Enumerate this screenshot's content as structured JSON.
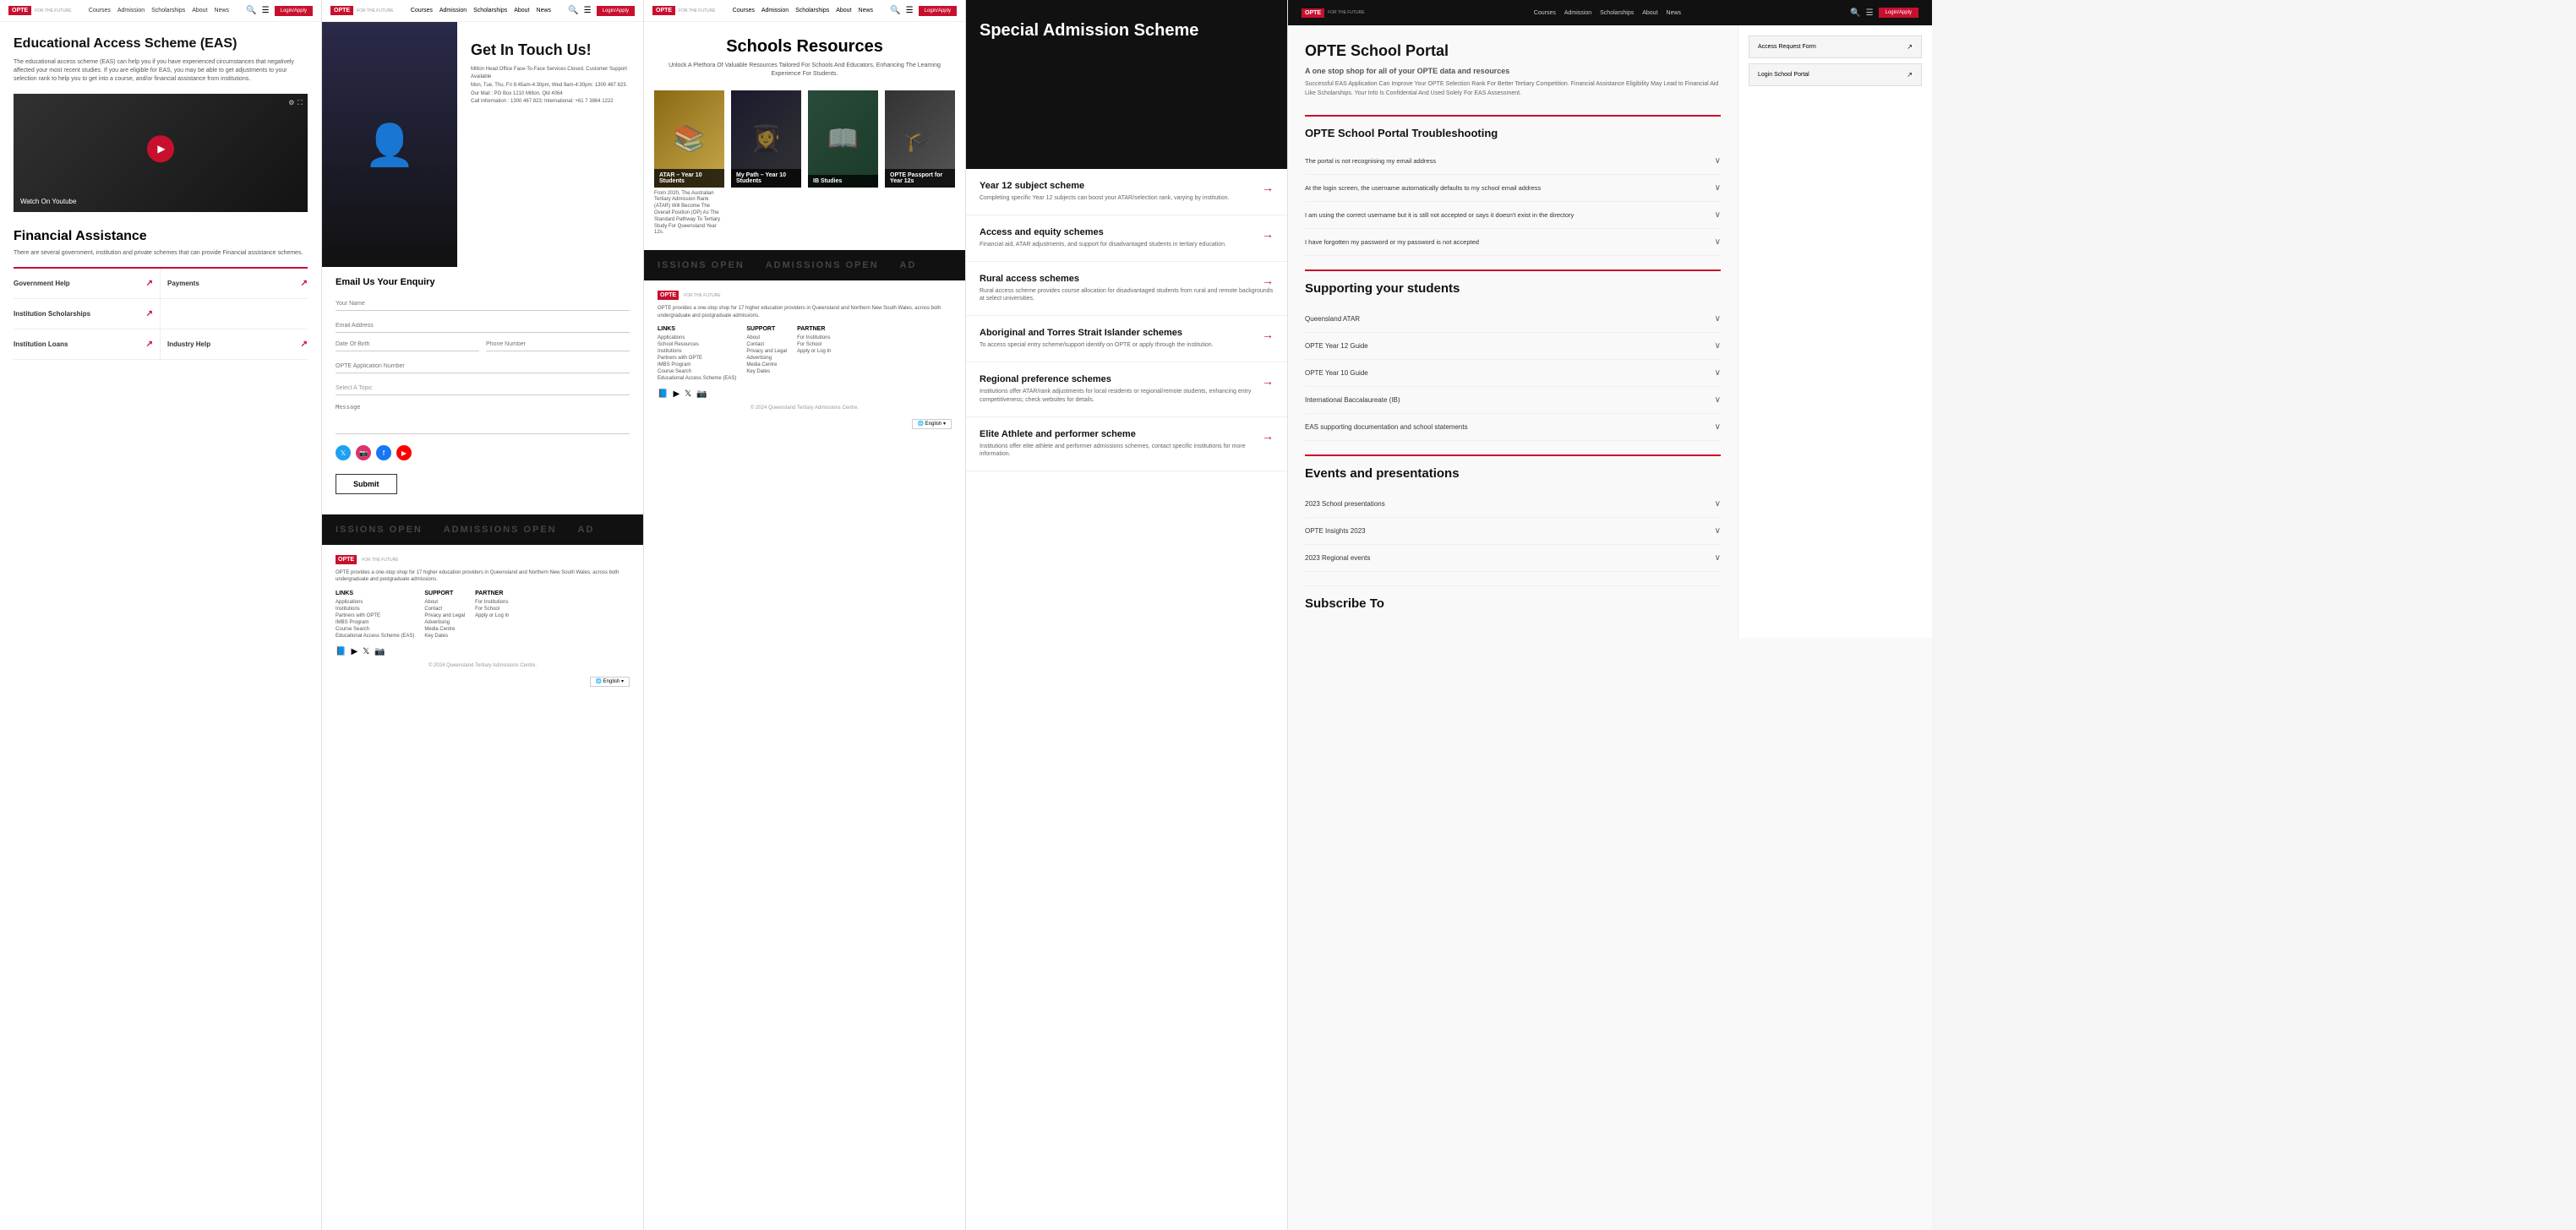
{
  "panel1": {
    "nav": {
      "logo": "OPTE",
      "links": [
        "Courses",
        "Admission",
        "Scholarships",
        "About",
        "News"
      ],
      "login": "Login/Apply"
    },
    "hero_title": "Educational Access Scheme (EAS)",
    "hero_text": "The educational access scheme (EAS) can help you if you have experienced circumstances that negatively affected your most recent studies. If you are eligible for EAS, you may be able to get adjustments to your selection rank to help you to get into a course, and/or financial assistance from institutions.",
    "video_label": "Watch On Youtube",
    "financial_title": "Financial Assistance",
    "financial_text": "There are several government, institution and private schemes that can provide Financial assistance schemes.",
    "links": [
      {
        "label": "Government Help",
        "arrow": "↗"
      },
      {
        "label": "Payments",
        "arrow": "↗"
      },
      {
        "label": "Institution Scholarships",
        "arrow": "↗"
      },
      {
        "label": "Institution Loans",
        "arrow": "↗"
      },
      {
        "label": "Industry Help",
        "arrow": "↗"
      }
    ]
  },
  "panel2": {
    "nav": {
      "logo": "OPTE",
      "links": [
        "Courses",
        "Admission",
        "Scholarships",
        "About",
        "News"
      ],
      "login": "Login/Apply"
    },
    "contact_title": "Get In Touch Us!",
    "contact_info_line1": "Milton Head Office Face-To-Face Services Closed. Customer Support Available",
    "contact_info_line2": "Mon, Tue, Thu, Fri 8:45am-4:30pm, Wed 9am-4:30pm: 1300 467 823.",
    "mail_label": "Our Mail : PO Box 1210 Milton, Qld 4064",
    "call_label": "Call Information : 1300 467 823; International: +61 7 3864 1222",
    "form_title": "Email Us Your Enquiry",
    "form_fields": [
      {
        "placeholder": "Your Name",
        "type": "text"
      },
      {
        "placeholder": "Email Address",
        "type": "text"
      },
      {
        "placeholder": "Date Of Birth",
        "type": "text"
      },
      {
        "placeholder": "Phone Number",
        "type": "text"
      },
      {
        "placeholder": "OPTE Application Number",
        "type": "text"
      },
      {
        "placeholder": "Select A Topic",
        "type": "select"
      },
      {
        "placeholder": "Message",
        "type": "textarea"
      }
    ],
    "submit_label": "Submit",
    "social_icons": [
      "twitter",
      "instagram",
      "facebook",
      "youtube"
    ],
    "admissions_banner": "ISSIONS OPEN    ADMISSIONS OPEN    AD",
    "footer": {
      "logo": "OPTE",
      "tagline": "FOR THE FUTURE",
      "desc": "OPTE provides a one-stop shop for 17 higher education providers in Queensland and Northern New South Wales, across both undergraduate and postgraduate admissions.",
      "cols": [
        {
          "title": "LINKS",
          "items": [
            "Applications",
            "Institutions",
            "Partners with OPTE",
            "IMBS Program",
            "Course Search",
            "Educational Access Scheme (EAS)"
          ]
        },
        {
          "title": "SUPPORT",
          "items": [
            "About",
            "Contact",
            "Privacy and Legal",
            "Advertising",
            "Media Centre",
            "Key Dates"
          ]
        },
        {
          "title": "PARTNER",
          "items": [
            "For Institutions",
            "For School",
            "Apply or Log In"
          ]
        }
      ],
      "copyright": "© 2024 Queensland Tertiary Admissions Centre."
    }
  },
  "panel3": {
    "nav": {
      "logo": "OPTE",
      "links": [
        "Courses",
        "Admission",
        "Scholarships",
        "About",
        "News"
      ],
      "login": "Login/Apply"
    },
    "page_title": "Schools Resources",
    "page_subtitle": "Unlock A Plethora Of Valuable Resources Tailored For Schools And Educators, Enhancing The Learning Experience For Students.",
    "resources": [
      {
        "label": "ATAR – Year 10 Students",
        "card_class": "card1"
      },
      {
        "label": "My Path – Year 10 Students",
        "card_class": "card2"
      },
      {
        "label": "IB Studies",
        "card_class": "card3"
      },
      {
        "label": "OPTE Passport for Year 12s",
        "card_class": "card4"
      }
    ],
    "resource_desc": "From 2020, The Australian Tertiary Admission Rank (ATAR) Will Become The Overall Position (OP) As The Standard Pathway To Tertiary Study For Queensland Year 12s.",
    "admissions_banner": "ISSIONS OPEN    ADMISSIONS OPEN    AD",
    "footer": {
      "logo": "OPTE",
      "desc": "OPTE provides a one-stop shop for 17 higher education providers in Queensland and Northern New South Wales, across both undergraduate and postgraduate admissions.",
      "cols": [
        {
          "title": "LINKS",
          "items": [
            "Applications",
            "School Resources",
            "Institutions",
            "Partners with OPTE",
            "IMBS Program",
            "Course Search",
            "Educational Access Scheme (EAS)"
          ]
        },
        {
          "title": "SUPPORT",
          "items": [
            "About",
            "Contact",
            "Privacy and Legal",
            "Advertising",
            "Media Centre",
            "Key Dates"
          ]
        },
        {
          "title": "PARTNER",
          "items": [
            "For Institutions",
            "For School",
            "Apply or Log In"
          ]
        }
      ],
      "copyright": "© 2024 Queensland Tertiary Admissions Centre."
    }
  },
  "panel4": {
    "header_title": "Special Admission Scheme",
    "schemes": [
      {
        "title": "Year 12 subject scheme",
        "desc": "Completing specific Year 12 subjects can boost your ATAR/selection rank, varying by institution.",
        "arrow": "→"
      },
      {
        "title": "Access and equity schemes",
        "desc": "Financial aid, ATAR adjustments, and support for disadvantaged students in tertiary education.",
        "arrow": "→"
      },
      {
        "title": "Rural access schemes",
        "desc": "Rural access scheme provides course allocation for disadvantaged students from rural and remote backgrounds at select universities.",
        "arrow": "→"
      },
      {
        "title": "Aboriginal and Torres Strait Islander schemes",
        "desc": "To access special entry scheme/support identify on OPTE or apply through the institution.",
        "arrow": "→"
      },
      {
        "title": "Regional preference schemes",
        "desc": "Institutions offer ATAR/rank adjustments for local residents or regional/remote students, enhancing entry competitiveness; check websites for details.",
        "arrow": "→"
      },
      {
        "title": "Elite Athlete and performer scheme",
        "desc": "Institutions offer elite athlete and performer admissions schemes, contact specific institutions for more information.",
        "arrow": "→"
      }
    ]
  },
  "panel5": {
    "nav": {
      "logo": "OPTE",
      "tagline": "FOR THE FUTURE",
      "links": [
        "Courses",
        "Admission",
        "Scholarships",
        "About",
        "News"
      ],
      "login": "Login/Apply"
    },
    "portal_title": "OPTE School Portal",
    "portal_subtitle": "A one stop shop for all of your OPTE data and resources",
    "portal_desc": "Successful EAS Application Can Improve Your OPTE Selection Rank For Better Tertiary Competition. Financial Assistance Eligibility May Lead to Financial Aid Like Scholarships. Your Info Is Confidential And Used Solely For EAS Assessment.",
    "sidebar_buttons": [
      {
        "label": "Access Request Form",
        "arrow": "↗"
      },
      {
        "label": "Login School Portal",
        "arrow": "↗"
      }
    ],
    "troubleshooting_title": "OPTE School Portal Troubleshooting",
    "trouble_items": [
      "The portal is not recognising my email address",
      "At the login screen, the username automatically defaults to my school email address",
      "I am using the correct username but it is still not accepted or says it doesn't exist in the directory",
      "I have forgotten my password or my password is not accepted"
    ],
    "supporting_title": "Supporting your students",
    "support_items": [
      "Queensland ATAR",
      "OPTE Year 12 Guide",
      "OPTE Year 10 Guide",
      "International Baccalaureate (IB)",
      "EAS supporting documentation and school statements"
    ],
    "events_title": "Events and presentations",
    "event_items": [
      "2023 School presentations",
      "OPTE Insights 2023",
      "2023 Regional events"
    ],
    "subscribe_title": "Subscribe To"
  }
}
